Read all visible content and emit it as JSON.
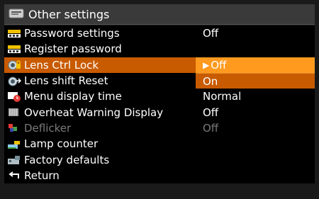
{
  "header": {
    "title": "Other settings",
    "icon": "settings-card-icon"
  },
  "menu": [
    {
      "name": "password-settings",
      "label": "Password settings",
      "value": "Off",
      "icon": "password-icon"
    },
    {
      "name": "register-password",
      "label": "Register password",
      "value": "",
      "icon": "register-password-icon"
    },
    {
      "name": "lens-ctrl-lock",
      "label": "Lens Ctrl Lock",
      "value": "Off",
      "icon": "lens-lock-icon",
      "selected": true
    },
    {
      "name": "lens-shift-reset",
      "label": "Lens shift Reset",
      "value": "On",
      "icon": "lens-shift-icon"
    },
    {
      "name": "menu-display-time",
      "label": "Menu display time",
      "value": "Normal",
      "icon": "menu-time-icon"
    },
    {
      "name": "overheat-warning-display",
      "label": "Overheat Warning Display",
      "value": "Off",
      "icon": "overheat-icon"
    },
    {
      "name": "deflicker",
      "label": "Deflicker",
      "value": "Off",
      "icon": "deflicker-icon",
      "disabled": true
    },
    {
      "name": "lamp-counter",
      "label": "Lamp counter",
      "value": "",
      "icon": "lamp-counter-icon"
    },
    {
      "name": "factory-defaults",
      "label": "Factory defaults",
      "value": "",
      "icon": "factory-defaults-icon"
    },
    {
      "name": "return",
      "label": "Return",
      "value": "",
      "icon": "return-icon"
    }
  ],
  "colors": {
    "selected_row": "#c85a00",
    "selected_value": "#ff9a1f",
    "disabled_text": "#7a7a7a"
  }
}
